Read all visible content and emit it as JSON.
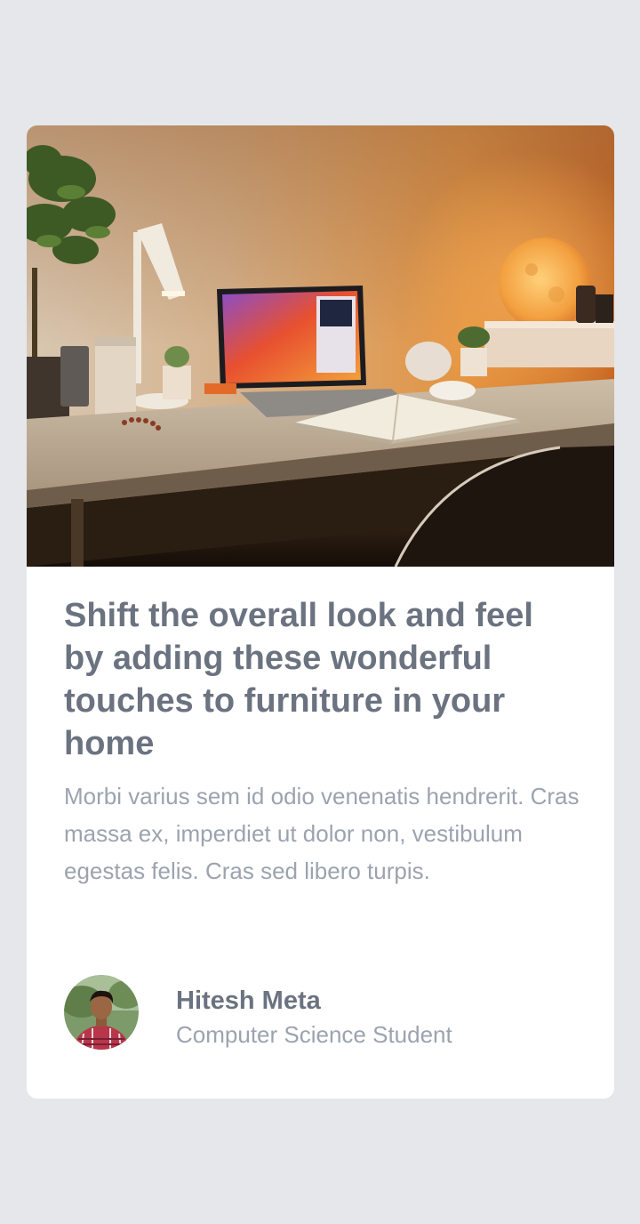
{
  "card": {
    "image_icon": "desk-lamp-laptop-photo",
    "title": "Shift the overall look and feel by adding these wonderful touches to furniture in your home",
    "description": "Morbi varius sem id odio venenatis hendrerit. Cras massa ex, imperdiet ut dolor non, vestibulum egestas felis. Cras sed libero turpis.",
    "author": {
      "name": "Hitesh Meta",
      "role": "Computer Science Student",
      "avatar_icon": "person-avatar-photo"
    }
  },
  "colors": {
    "page_background": "#e5e7eb",
    "card_background": "#ffffff",
    "title_text": "#6b7280",
    "body_text": "#9ca3af"
  }
}
